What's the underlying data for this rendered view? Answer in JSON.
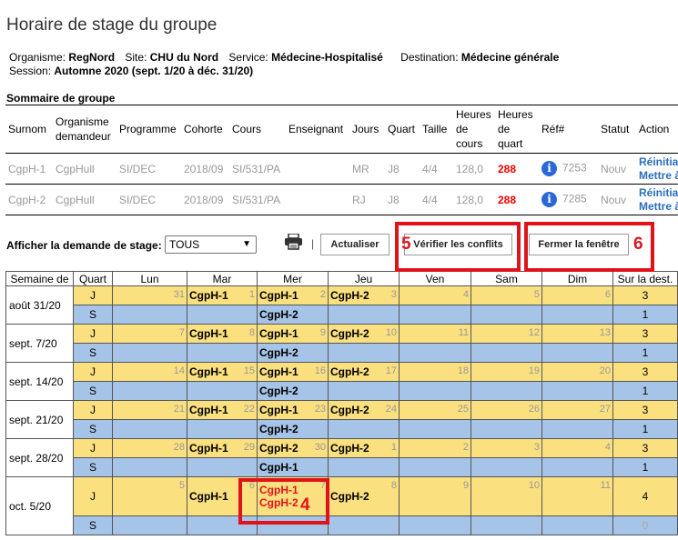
{
  "page": {
    "title": "Horaire de stage du groupe",
    "info": {
      "organisme_label": "Organisme:",
      "organisme": "RegNord",
      "site_label": "Site:",
      "site": "CHU du Nord",
      "service_label": "Service:",
      "service": "Médecine-Hospitalisé",
      "destination_label": "Destination:",
      "destination": "Médecine générale",
      "session_label": "Session:",
      "session": "Automne 2020",
      "session_range": "(sept. 1/20 à déc. 31/20)"
    }
  },
  "summary": {
    "title": "Sommaire de groupe",
    "headers": {
      "surnom": "Surnom",
      "organisme": "Organisme demandeur",
      "programme": "Programme",
      "cohorte": "Cohorte",
      "cours": "Cours",
      "enseignant": "Enseignant",
      "jours": "Jours",
      "quart": "Quart",
      "taille": "Taille",
      "heures_cours": "Heures de cours",
      "heures_quart": "Heures de quart",
      "ref": "Réf#",
      "statut": "Statut",
      "action": "Action"
    },
    "rows": [
      {
        "surnom": "CgpH-1",
        "organisme": "CgpHull",
        "programme": "SI/DEC",
        "cohorte": "2018/09",
        "cours": "SI/531/PA",
        "enseignant": "",
        "jours": "MR",
        "quart": "J8",
        "taille": "4/4",
        "heures_cours": "128,0",
        "heures_quart": "288",
        "ref": "7253",
        "statut": "Nouv",
        "action1": "Réinitial",
        "action2": "Mettre à"
      },
      {
        "surnom": "CgpH-2",
        "organisme": "CgpHull",
        "programme": "SI/DEC",
        "cohorte": "2018/09",
        "cours": "SI/531/PA",
        "enseignant": "",
        "jours": "RJ",
        "quart": "J8",
        "taille": "4/4",
        "heures_cours": "128,0",
        "heures_quart": "288",
        "ref": "7285",
        "statut": "Nouv",
        "action1": "Réinitial",
        "action2": "Mettre à"
      }
    ]
  },
  "controls": {
    "filter_label": "Afficher la demande de stage:",
    "filter_value": "TOUS",
    "separator": "|",
    "refresh_button": "Actualiser",
    "check_conflicts_button": "Vérifier les conflits",
    "close_button": "Fermer la fenêtre"
  },
  "annotations": {
    "n4": "4",
    "n5": "5",
    "n6": "6"
  },
  "colors": {
    "accent_red": "#e0131b",
    "day_shift": "#fbe080",
    "night_shift": "#a6c4e8",
    "link": "#2a6ebb"
  },
  "calendar": {
    "headers": [
      "Semaine de",
      "Quart",
      "Lun",
      "Mar",
      "Mer",
      "Jeu",
      "Ven",
      "Sam",
      "Dim",
      "Sur la dest."
    ],
    "weeks": [
      {
        "label": "août 31/20",
        "j": {
          "days": [
            {
              "n": "31",
              "g": []
            },
            {
              "n": "1",
              "g": [
                "CgpH-1"
              ]
            },
            {
              "n": "2",
              "g": [
                "CgpH-1"
              ]
            },
            {
              "n": "3",
              "g": [
                "CgpH-2"
              ]
            },
            {
              "n": "4",
              "g": []
            },
            {
              "n": "5",
              "g": []
            },
            {
              "n": "6",
              "g": []
            }
          ],
          "sur": "3"
        },
        "s": {
          "days": [
            {
              "g": []
            },
            {
              "g": []
            },
            {
              "g": [
                "CgpH-2"
              ]
            },
            {
              "g": []
            },
            {
              "g": []
            },
            {
              "g": []
            },
            {
              "g": []
            }
          ],
          "sur": "1"
        }
      },
      {
        "label": "sept. 7/20",
        "j": {
          "days": [
            {
              "n": "7",
              "g": []
            },
            {
              "n": "8",
              "g": [
                "CgpH-1"
              ]
            },
            {
              "n": "9",
              "g": [
                "CgpH-1"
              ]
            },
            {
              "n": "10",
              "g": [
                "CgpH-2"
              ]
            },
            {
              "n": "11",
              "g": []
            },
            {
              "n": "12",
              "g": []
            },
            {
              "n": "13",
              "g": []
            }
          ],
          "sur": "3"
        },
        "s": {
          "days": [
            {
              "g": []
            },
            {
              "g": []
            },
            {
              "g": [
                "CgpH-2"
              ]
            },
            {
              "g": []
            },
            {
              "g": []
            },
            {
              "g": []
            },
            {
              "g": []
            }
          ],
          "sur": "1"
        }
      },
      {
        "label": "sept. 14/20",
        "j": {
          "days": [
            {
              "n": "14",
              "g": []
            },
            {
              "n": "15",
              "g": [
                "CgpH-1"
              ]
            },
            {
              "n": "16",
              "g": [
                "CgpH-1"
              ]
            },
            {
              "n": "17",
              "g": [
                "CgpH-2"
              ]
            },
            {
              "n": "18",
              "g": []
            },
            {
              "n": "19",
              "g": []
            },
            {
              "n": "20",
              "g": []
            }
          ],
          "sur": "3"
        },
        "s": {
          "days": [
            {
              "g": []
            },
            {
              "g": []
            },
            {
              "g": [
                "CgpH-2"
              ]
            },
            {
              "g": []
            },
            {
              "g": []
            },
            {
              "g": []
            },
            {
              "g": []
            }
          ],
          "sur": "1"
        }
      },
      {
        "label": "sept. 21/20",
        "j": {
          "days": [
            {
              "n": "21",
              "g": []
            },
            {
              "n": "22",
              "g": [
                "CgpH-1"
              ]
            },
            {
              "n": "23",
              "g": [
                "CgpH-1"
              ]
            },
            {
              "n": "24",
              "g": [
                "CgpH-2"
              ]
            },
            {
              "n": "25",
              "g": []
            },
            {
              "n": "26",
              "g": []
            },
            {
              "n": "27",
              "g": []
            }
          ],
          "sur": "3"
        },
        "s": {
          "days": [
            {
              "g": []
            },
            {
              "g": []
            },
            {
              "g": [
                "CgpH-2"
              ]
            },
            {
              "g": []
            },
            {
              "g": []
            },
            {
              "g": []
            },
            {
              "g": []
            }
          ],
          "sur": "1"
        }
      },
      {
        "label": "sept. 28/20",
        "j": {
          "days": [
            {
              "n": "28",
              "g": []
            },
            {
              "n": "29",
              "g": [
                "CgpH-1"
              ]
            },
            {
              "n": "30",
              "g": [
                "CgpH-2"
              ]
            },
            {
              "n": "1",
              "g": [
                "CgpH-2"
              ]
            },
            {
              "n": "2",
              "g": []
            },
            {
              "n": "3",
              "g": []
            },
            {
              "n": "4",
              "g": []
            }
          ],
          "sur": "3"
        },
        "s": {
          "days": [
            {
              "g": []
            },
            {
              "g": []
            },
            {
              "g": [
                "CgpH-1"
              ]
            },
            {
              "g": []
            },
            {
              "g": []
            },
            {
              "g": []
            },
            {
              "g": []
            }
          ],
          "sur": "1"
        }
      },
      {
        "label": "oct. 5/20",
        "j": {
          "days": [
            {
              "n": "5",
              "g": []
            },
            {
              "n": "6",
              "g": [
                "CgpH-1"
              ]
            },
            {
              "n": "7",
              "g": [
                "CgpH-1",
                "CgpH-2"
              ],
              "conflict": true
            },
            {
              "n": "8",
              "g": [
                "CgpH-2"
              ]
            },
            {
              "n": "9",
              "g": []
            },
            {
              "n": "10",
              "g": []
            },
            {
              "n": "11",
              "g": []
            }
          ],
          "sur": "4"
        },
        "s": {
          "days": [
            {
              "g": []
            },
            {
              "g": []
            },
            {
              "g": []
            },
            {
              "g": []
            },
            {
              "g": []
            },
            {
              "g": []
            },
            {
              "g": []
            }
          ],
          "sur": "0",
          "sur_grey": true
        }
      }
    ]
  }
}
